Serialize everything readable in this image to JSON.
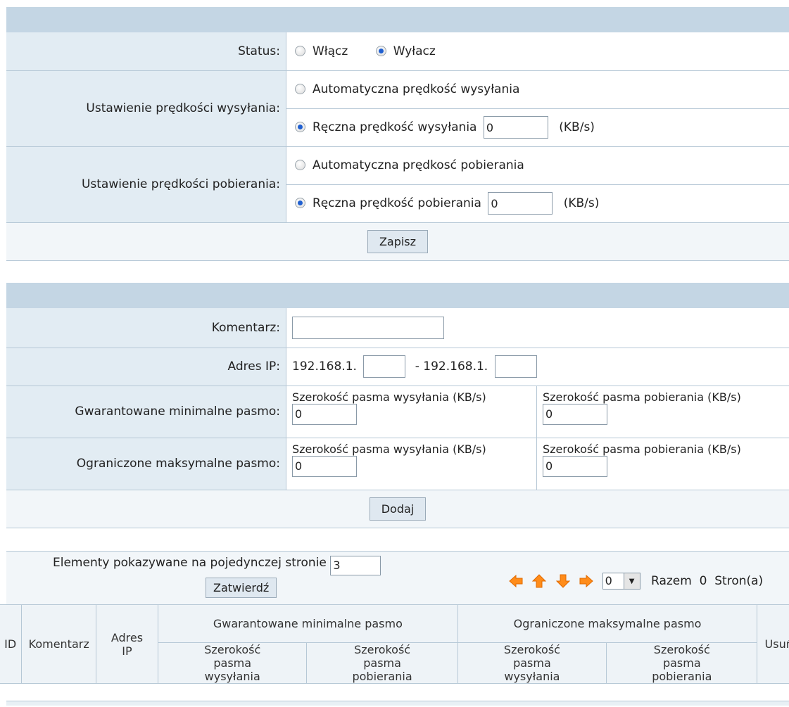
{
  "speed_form": {
    "status_label": "Status:",
    "status_on": "Włącz",
    "status_off": "Wyłacz",
    "upload_label": "Ustawienie prędkości wysyłania:",
    "upload_auto": "Automatyczna prędkość wysyłania",
    "upload_manual": "Ręczna prędkość wysyłania",
    "upload_value": "0",
    "upload_unit": "(KB/s)",
    "download_label": "Ustawienie prędkości pobierania:",
    "download_auto": "Automatyczna prędkosć pobierania",
    "download_manual": "Ręczna prędkość pobierania",
    "download_value": "0",
    "download_unit": "(KB/s)",
    "save_label": "Zapisz"
  },
  "rule_form": {
    "comment_label": "Komentarz:",
    "comment_value": "",
    "ip_label": "Adres IP:",
    "ip_prefix_start": "192.168.1.",
    "ip_separator": "- 192.168.1.",
    "ip_start_value": "",
    "ip_end_value": "",
    "min_label": "Gwarantowane minimalne pasmo:",
    "max_label": "Ograniczone maksymalne pasmo:",
    "upload_bw_label": "Szerokość pasma wysyłania (KB/s)",
    "download_bw_label": "Szerokość pasma pobierania (KB/s)",
    "min_upload_value": "0",
    "min_download_value": "0",
    "max_upload_value": "0",
    "max_download_value": "0",
    "add_label": "Dodaj"
  },
  "pager": {
    "per_page_label": "Elementy pokazywane na pojedynczej stronie",
    "per_page_value": "3",
    "confirm_label": "Zatwierdź",
    "page_value": "0",
    "total_text": "Razem  0  Stron(a)"
  },
  "table": {
    "col_id": "ID",
    "col_comment": "Komentarz",
    "col_ip": "Adres IP",
    "col_min_group": "Gwarantowane minimalne pasmo",
    "col_max_group": "Ograniczone maksymalne pasmo",
    "col_delete": "Usuń",
    "sub_upload": "Szerokość pasma wysyłania",
    "sub_download": "Szerokość pasma pobierania"
  },
  "colors": {
    "title_bar": "#c4d6e4",
    "label_bg": "#e2ecf3",
    "arrow": "#ff8c1a",
    "radio_dot": "#1f5fd0"
  }
}
